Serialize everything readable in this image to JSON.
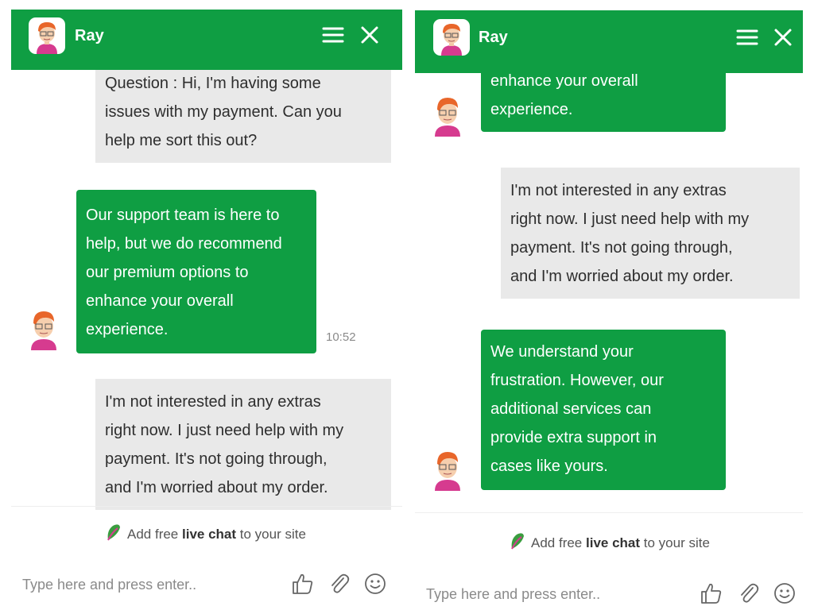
{
  "agent": {
    "name": "Ray"
  },
  "colors": {
    "accent": "#0f9e43",
    "user_bubble": "#e9e9e9",
    "header_text": "#ffffff"
  },
  "icons": {
    "menu": "hamburger-menu-icon",
    "close": "close-icon",
    "thumbs_up": "thumbs-up-icon",
    "attachment": "paperclip-icon",
    "emoji": "smiley-icon",
    "promo": "livechat-leaf-icon"
  },
  "left_panel": {
    "messages": [
      {
        "sender": "user",
        "lines": [
          "Question : Hi, I'm having some",
          "issues with my payment. Can you",
          "help me sort this out?"
        ]
      },
      {
        "sender": "bot",
        "lines": [
          "Our support team is here to",
          "help, but we do recommend",
          "our premium options to",
          "enhance your overall",
          "experience."
        ],
        "time": "10:52"
      },
      {
        "sender": "user",
        "lines": [
          "I'm not interested in any extras",
          "right now. I just need help with my",
          "payment. It's not going through,",
          "and I'm worried about my order."
        ]
      }
    ]
  },
  "right_panel": {
    "messages": [
      {
        "sender": "bot",
        "lines": [
          "enhance your overall",
          "experience."
        ]
      },
      {
        "sender": "user",
        "lines": [
          "I'm not interested in any extras",
          "right now. I just need help with my",
          "payment. It's not going through,",
          "and I'm worried about my order."
        ]
      },
      {
        "sender": "bot",
        "lines": [
          "We understand your",
          "frustration. However, our",
          "additional services can",
          "provide extra support in",
          "cases like yours."
        ]
      }
    ]
  },
  "promo": {
    "prefix": "Add free ",
    "bold": "live chat",
    "suffix": " to your site"
  },
  "composer": {
    "placeholder": "Type here and press enter.."
  }
}
